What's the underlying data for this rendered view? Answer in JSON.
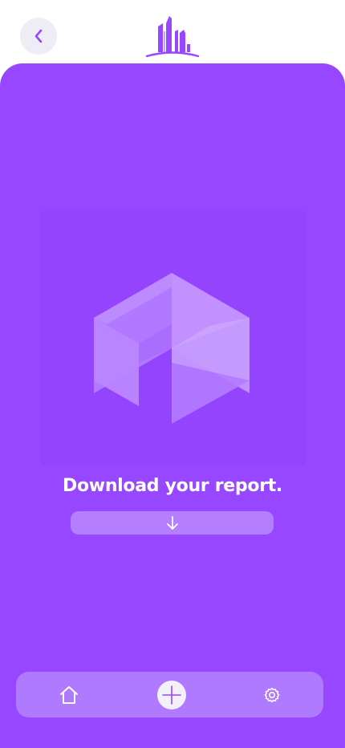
{
  "header": {
    "back_icon": "chevron-left-icon",
    "logo_icon": "city-buildings-logo"
  },
  "main": {
    "illustration_icon": "isometric-cube-illustration",
    "title": "Download your report.",
    "download_icon": "arrow-down-icon"
  },
  "bottom_nav": {
    "items": [
      {
        "icon": "home-icon"
      },
      {
        "icon": "plus-icon"
      },
      {
        "icon": "gear-icon"
      }
    ]
  },
  "colors": {
    "primary": "#9747ff",
    "light": "#b57eff",
    "back_button_bg": "#eeecf4",
    "white": "#ffffff"
  }
}
